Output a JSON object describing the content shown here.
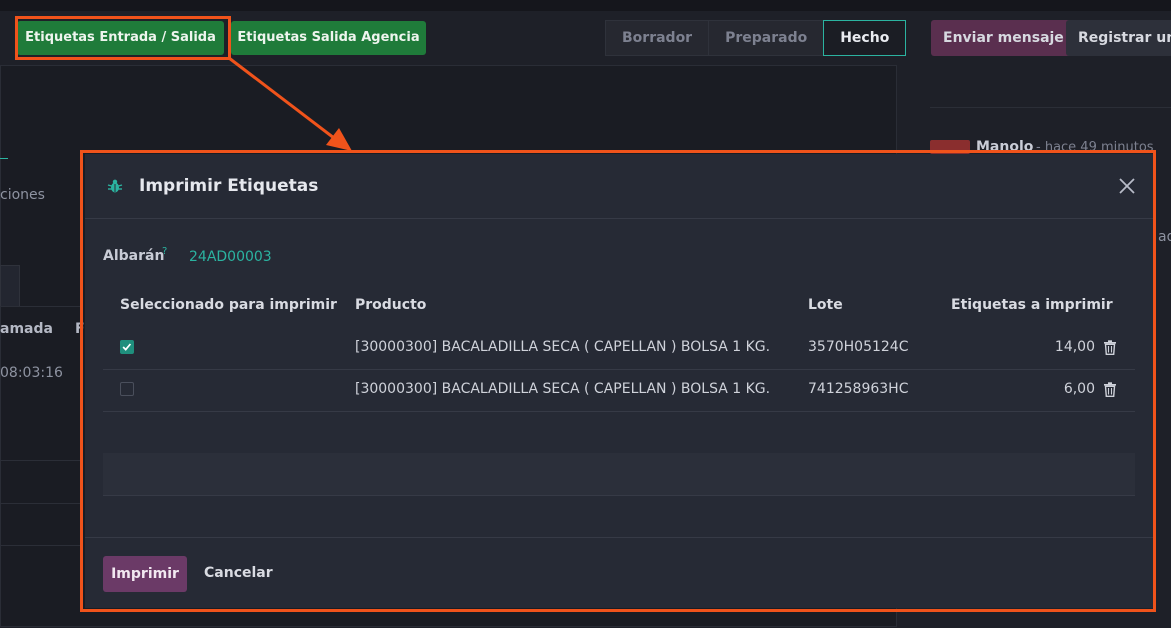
{
  "toolbar": {
    "btn_entrada_salida": "Etiquetas Entrada / Salida",
    "btn_salida_agencia": "Etiquetas Salida Agencia"
  },
  "status_steps": [
    "Borrador",
    "Preparado",
    "Hecho"
  ],
  "chatter": {
    "send_message": "Enviar mensaje",
    "log_note": "Registrar una",
    "author": "Manolo",
    "time": "- hace 49 minutos",
    "partial_right": "ad"
  },
  "background": {
    "partial_ciones": "ciones",
    "partial_amada": "amada",
    "partial_F": "F",
    "partial_time": "08:03:16"
  },
  "modal": {
    "title": "Imprimir Etiquetas",
    "field_label": "Albarán",
    "field_help": "?",
    "field_value": "24AD00003",
    "columns": [
      "Seleccionado para imprimir",
      "Producto",
      "Lote",
      "Etiquetas a imprimir"
    ],
    "rows": [
      {
        "checked": true,
        "product": "[30000300] BACALADILLA SECA ( CAPELLAN ) BOLSA 1 KG.",
        "lot": "3570H05124C",
        "qty": "14,00"
      },
      {
        "checked": false,
        "product": "[30000300] BACALADILLA SECA ( CAPELLAN ) BOLSA 1 KG.",
        "lot": "741258963HC",
        "qty": "6,00"
      }
    ],
    "print_button": "Imprimir",
    "cancel_button": "Cancelar"
  },
  "colors": {
    "accent_teal": "#2bb3a0",
    "primary_purple": "#6b3a67",
    "annotation_orange": "#f0531b",
    "button_green": "#1f7b3a"
  }
}
